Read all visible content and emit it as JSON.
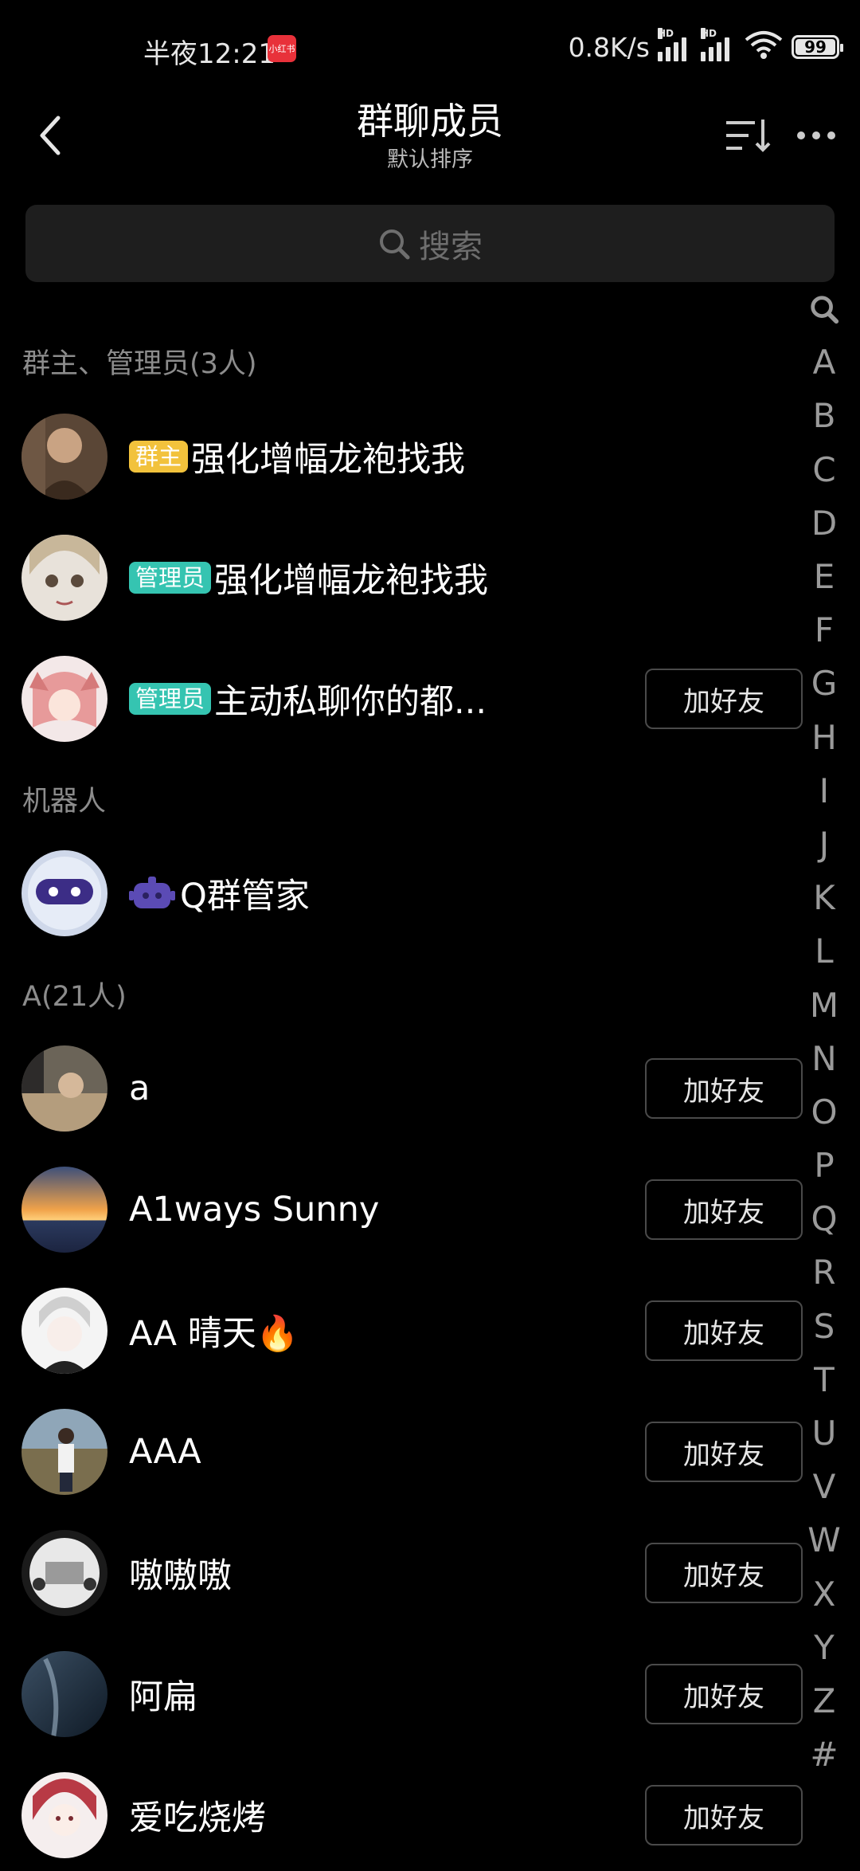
{
  "status_bar": {
    "time": "半夜12:21",
    "app_badge": "小红书",
    "net_speed": "0.8K/s",
    "signal_label": "HD",
    "wifi_label": "6",
    "battery": "99"
  },
  "header": {
    "title": "群聊成员",
    "subtitle": "默认排序"
  },
  "search": {
    "placeholder": "搜索"
  },
  "sections": {
    "admins": "群主、管理员(3人)",
    "robots": "机器人",
    "a_group": "A(21人)"
  },
  "admins": [
    {
      "tag": "群主",
      "name": "强化增幅龙袍找我"
    },
    {
      "tag": "管理员",
      "name": "强化增幅龙袍找我"
    },
    {
      "tag": "管理员",
      "name": "主动私聊你的都...",
      "button": "加好友"
    }
  ],
  "robots": [
    {
      "name": "Q群管家"
    }
  ],
  "members": [
    {
      "name": "a",
      "button": "加好友"
    },
    {
      "name": "A1ways Sunny",
      "button": "加好友"
    },
    {
      "name": "AA  晴天🔥",
      "button": "加好友"
    },
    {
      "name": "AAA",
      "button": "加好友"
    },
    {
      "name": "嗷嗷嗷",
      "button": "加好友"
    },
    {
      "name": "阿扁",
      "button": "加好友"
    },
    {
      "name": "爱吃烧烤",
      "button": "加好友"
    }
  ],
  "index_letters": [
    "🔍",
    "A",
    "B",
    "C",
    "D",
    "E",
    "F",
    "G",
    "H",
    "I",
    "J",
    "K",
    "L",
    "M",
    "N",
    "O",
    "P",
    "Q",
    "R",
    "S",
    "T",
    "U",
    "V",
    "W",
    "X",
    "Y",
    "Z",
    "#"
  ]
}
